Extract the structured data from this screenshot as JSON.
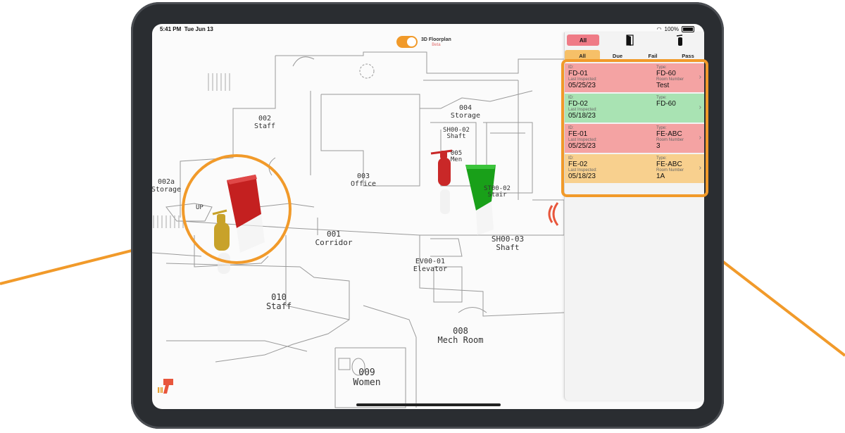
{
  "status": {
    "time": "5:41 PM",
    "date": "Tue Jun 13",
    "battery": "100%"
  },
  "floorplan_toggle": {
    "label": "3D Floorplan",
    "sublabel": "Beta",
    "enabled": true
  },
  "rooms": [
    {
      "number": "002",
      "name": "Staff"
    },
    {
      "number": "004",
      "name": "Storage"
    },
    {
      "number": "SH00-02",
      "name": "Shaft"
    },
    {
      "number": "003",
      "name": "Office"
    },
    {
      "number": "005",
      "name": "Men"
    },
    {
      "number": "ST00-02",
      "name": "Stair"
    },
    {
      "number": "002a",
      "name": "Storage"
    },
    {
      "number": "001",
      "name": "Corridor"
    },
    {
      "number": "SH00-03",
      "name": "Shaft"
    },
    {
      "number": "EV00-01",
      "name": "Elevator"
    },
    {
      "number": "010",
      "name": "Staff"
    },
    {
      "number": "008",
      "name": "Mech Room"
    },
    {
      "number": "009",
      "name": "Women"
    }
  ],
  "stair_label": "UP",
  "panel": {
    "filter_all_label": "All",
    "type_icons": [
      "fire-door-icon",
      "fire-extinguisher-icon"
    ],
    "tabs": [
      {
        "label": "All",
        "active": true
      },
      {
        "label": "Due",
        "active": false
      },
      {
        "label": "Fail",
        "active": false
      },
      {
        "label": "Pass",
        "active": false
      }
    ],
    "items": [
      {
        "id_label": "ID:",
        "id": "FD-01",
        "type_label": "Type:",
        "type": "FD-60",
        "inspected_label": "Last Inspected:",
        "inspected": "05/25/23",
        "room_label": "Room Number",
        "room": "Test",
        "status": "fail"
      },
      {
        "id_label": "ID:",
        "id": "FD-02",
        "type_label": "Type:",
        "type": "FD-60",
        "inspected_label": "Last Inspected:",
        "inspected": "05/18/23",
        "room_label": "",
        "room": "",
        "status": "pass"
      },
      {
        "id_label": "ID:",
        "id": "FE-01",
        "type_label": "Type:",
        "type": "FE-ABC",
        "inspected_label": "Last Inspected:",
        "inspected": "05/25/23",
        "room_label": "Room Number",
        "room": "3",
        "status": "fail"
      },
      {
        "id_label": "ID:",
        "id": "FE-02",
        "type_label": "Type:",
        "type": "FE-ABC",
        "inspected_label": "Last Inspected:",
        "inspected": "05/18/23",
        "room_label": "Room Number",
        "room": "1A",
        "status": "due"
      }
    ]
  },
  "colors": {
    "accent": "#f19a2a",
    "fail": "#f4a3a3",
    "pass": "#a9e3b3",
    "due": "#f8d08e",
    "pink": "#ef7b86"
  }
}
